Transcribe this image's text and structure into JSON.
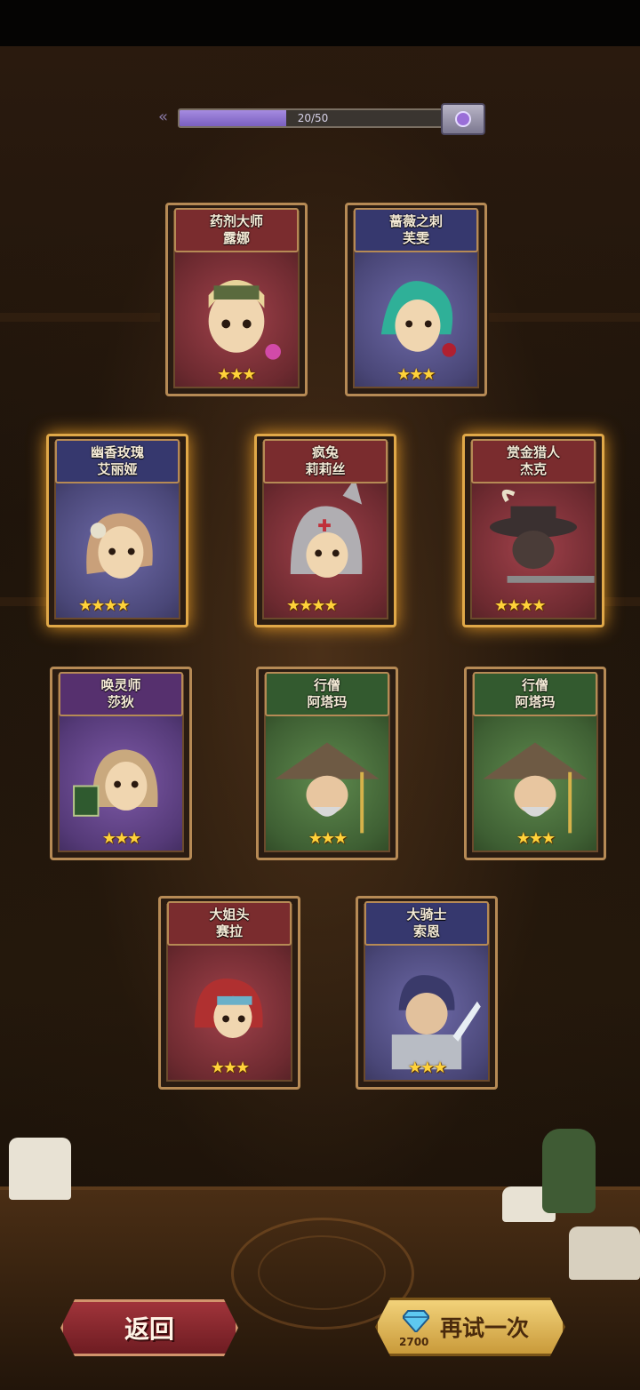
{
  "progress": {
    "text": "20/50",
    "current": 20,
    "max": 50
  },
  "cards": [
    {
      "title": "药剂大师",
      "name": "露娜",
      "stars": "★★★",
      "theme": "red"
    },
    {
      "title": "蔷薇之刺",
      "name": "芙雯",
      "stars": "★★★",
      "theme": "blue"
    },
    {
      "title": "幽香玫瑰",
      "name": "艾丽娅",
      "stars": "★★★★",
      "theme": "blue"
    },
    {
      "title": "疯兔",
      "name": "莉莉丝",
      "stars": "★★★★",
      "theme": "red"
    },
    {
      "title": "赏金猎人",
      "name": "杰克",
      "stars": "★★★★",
      "theme": "red"
    },
    {
      "title": "唤灵师",
      "name": "莎狄",
      "stars": "★★★",
      "theme": "purple"
    },
    {
      "title": "行僧",
      "name": "阿塔玛",
      "stars": "★★★",
      "theme": "green"
    },
    {
      "title": "行僧",
      "name": "阿塔玛",
      "stars": "★★★",
      "theme": "green"
    },
    {
      "title": "大姐头",
      "name": "赛拉",
      "stars": "★★★",
      "theme": "red"
    },
    {
      "title": "大骑士",
      "name": "索恩",
      "stars": "★★★",
      "theme": "blue"
    }
  ],
  "buttons": {
    "back_label": "返回",
    "retry_label": "再试一次",
    "retry_cost": "2700"
  },
  "colors": {
    "glow": "#ffaa28",
    "progress_fill": "#8d72d0"
  }
}
